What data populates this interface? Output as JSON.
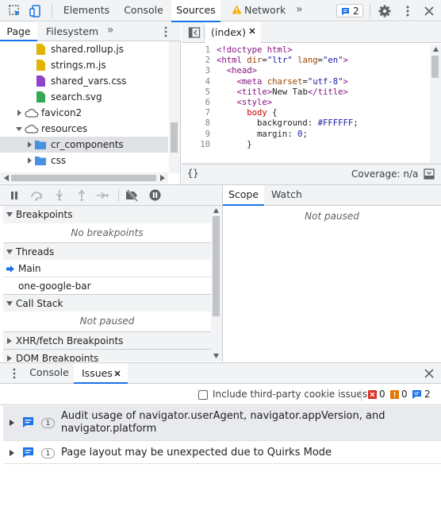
{
  "toolbar": {
    "tabs": [
      "Elements",
      "Console",
      "Sources",
      "Network"
    ],
    "active_tab": "Sources",
    "messages_count": "2",
    "accent": "#1a73e8"
  },
  "navigator": {
    "tabs": [
      "Page",
      "Filesystem"
    ],
    "files": [
      {
        "name": "shared.rollup.js",
        "icon": "js-file-icon"
      },
      {
        "name": "strings.m.js",
        "icon": "js-file-icon"
      },
      {
        "name": "shared_vars.css",
        "icon": "css-file-icon"
      },
      {
        "name": "search.svg",
        "icon": "image-file-icon"
      },
      {
        "name": "favicon2",
        "icon": "cloud-icon"
      },
      {
        "name": "resources",
        "icon": "cloud-icon"
      },
      {
        "name": "cr_components",
        "icon": "folder-icon"
      },
      {
        "name": "css",
        "icon": "folder-icon"
      }
    ]
  },
  "editor": {
    "open_file": "(index)",
    "line_numbers": [
      "1",
      "2",
      "3",
      "4",
      "5",
      "6",
      "7",
      "8",
      "9",
      "10"
    ],
    "format_label": "{}",
    "coverage": "Coverage: n/a"
  },
  "debugger": {
    "breakpoints_title": "Breakpoints",
    "no_breakpoints": "No breakpoints",
    "threads_title": "Threads",
    "threads": [
      "Main",
      "one-google-bar"
    ],
    "call_stack_title": "Call Stack",
    "not_paused": "Not paused",
    "xhr_title": "XHR/fetch Breakpoints",
    "dom_title": "DOM Breakpoints",
    "scope_tabs": [
      "Scope",
      "Watch"
    ],
    "scope_not_paused": "Not paused"
  },
  "drawer": {
    "tabs": [
      "Console",
      "Issues"
    ],
    "third_party_label": "Include third-party cookie issues",
    "counts": {
      "errors": "0",
      "warnings": "0",
      "info": "2"
    },
    "issues": [
      {
        "count": "1",
        "text": "Audit usage of navigator.userAgent, navigator.appVersion, and navigator.platform"
      },
      {
        "count": "1",
        "text": "Page layout may be unexpected due to Quirks Mode"
      }
    ]
  }
}
